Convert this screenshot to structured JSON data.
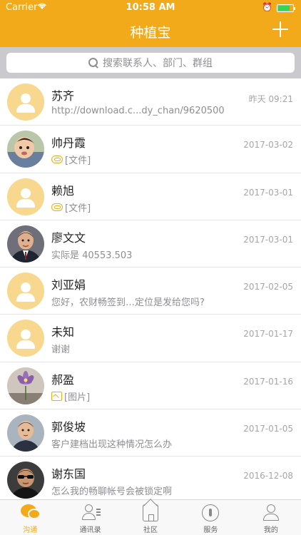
{
  "status_bar": {
    "carrier": "Carrier",
    "time": "10:58 AM"
  },
  "header": {
    "title": "种植宝"
  },
  "search": {
    "placeholder": "搜索联系人、部门、群组"
  },
  "conversations": [
    {
      "name": "苏齐",
      "message": "http://download.c...dy_chan/9620500",
      "date": "昨天 09:21",
      "avatar": "default",
      "attachment": null
    },
    {
      "name": "帅丹霞",
      "message": "[文件]",
      "date": "2017-03-02",
      "avatar": "photo-child",
      "attachment": "file"
    },
    {
      "name": "赖旭",
      "message": "[文件]",
      "date": "2017-03-01",
      "avatar": "default",
      "attachment": "file"
    },
    {
      "name": "廖文文",
      "message": "实际是 40553.503",
      "date": "2017-03-01",
      "avatar": "photo-man-suit",
      "attachment": null
    },
    {
      "name": "刘亚娟",
      "message": "您好，农财畅签到…定位是发给您吗?",
      "date": "2017-02-05",
      "avatar": "default",
      "attachment": null
    },
    {
      "name": "未知",
      "message": "谢谢",
      "date": "2017-01-17",
      "avatar": "default",
      "attachment": null
    },
    {
      "name": "郝盈",
      "message": "[图片]",
      "date": "2017-01-16",
      "avatar": "photo-flower",
      "attachment": "image"
    },
    {
      "name": "郭俊坡",
      "message": "客户建档出现这种情况怎么办",
      "date": "2017-01-05",
      "avatar": "photo-man",
      "attachment": null
    },
    {
      "name": "谢东国",
      "message": "怎么我的畅聊帐号会被锁定啊",
      "date": "2016-12-08",
      "avatar": "photo-man-sunglasses",
      "attachment": null
    }
  ],
  "tabbar": {
    "tabs": [
      {
        "label": "沟通",
        "icon": "chat-icon",
        "active": true
      },
      {
        "label": "通讯录",
        "icon": "contacts-icon",
        "active": false
      },
      {
        "label": "社区",
        "icon": "community-icon",
        "active": false
      },
      {
        "label": "服务",
        "icon": "service-icon",
        "active": false
      },
      {
        "label": "我的",
        "icon": "me-icon",
        "active": false
      }
    ]
  },
  "colors": {
    "brand": "#f2aa1a",
    "avatar_default": "#f8d88e",
    "text_secondary": "#8e8e93"
  }
}
